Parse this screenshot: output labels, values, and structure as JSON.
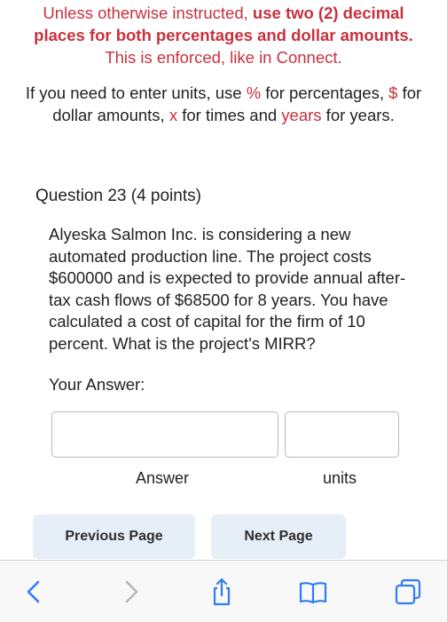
{
  "instructions": {
    "part1": "Unless otherwise instructed, ",
    "part2_bold": "use two (2) decimal places for both percentages and dollar amounts.",
    "part3": " This is enforced, like in Connect."
  },
  "units_note": {
    "t1": "If you need to enter units, use ",
    "pct_symbol": "%",
    "t2": " for percentages, ",
    "dollar_symbol": "$",
    "t3": " for dollar amounts, ",
    "times_symbol": "x",
    "t4": " for times and ",
    "years_word": "years",
    "t5": " for years."
  },
  "question": {
    "title": "Question 23",
    "points": "(4 points)",
    "text": "Alyeska Salmon Inc. is considering a new automated production line. The project costs $600000 and is expected to provide annual after-tax cash flows of $68500 for 8 years. You have calculated a cost of capital for the firm of 10 percent. What is the project's MIRR?"
  },
  "answer": {
    "prompt": "Your Answer:",
    "answer_value": "",
    "units_value": "",
    "answer_label": "Answer",
    "units_label": "units"
  },
  "navigation": {
    "previous_label": "Previous Page",
    "next_label": "Next Page"
  },
  "browser_toolbar": {
    "icons": [
      "back-icon",
      "forward-icon",
      "share-icon",
      "bookmarks-icon",
      "tabs-icon"
    ],
    "active_color": "#2f7cf6",
    "disabled_color": "#b9b9b9"
  },
  "colors": {
    "warning_red": "#c8313d",
    "button_bg": "#e6eef8"
  }
}
